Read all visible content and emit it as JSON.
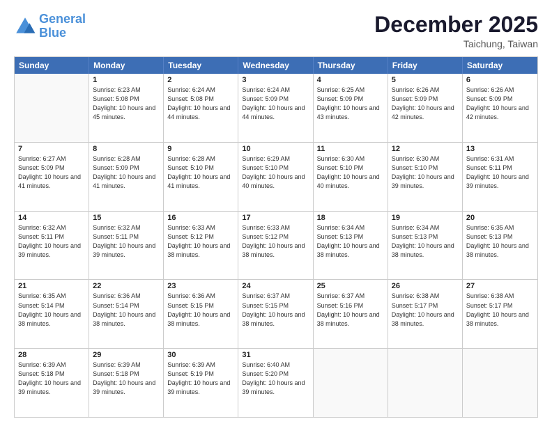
{
  "logo": {
    "line1": "General",
    "line2": "Blue"
  },
  "header": {
    "month": "December 2025",
    "location": "Taichung, Taiwan"
  },
  "days": [
    "Sunday",
    "Monday",
    "Tuesday",
    "Wednesday",
    "Thursday",
    "Friday",
    "Saturday"
  ],
  "weeks": [
    [
      {
        "day": "",
        "sunrise": "",
        "sunset": "",
        "daylight": ""
      },
      {
        "day": "1",
        "sunrise": "Sunrise: 6:23 AM",
        "sunset": "Sunset: 5:08 PM",
        "daylight": "Daylight: 10 hours and 45 minutes."
      },
      {
        "day": "2",
        "sunrise": "Sunrise: 6:24 AM",
        "sunset": "Sunset: 5:08 PM",
        "daylight": "Daylight: 10 hours and 44 minutes."
      },
      {
        "day": "3",
        "sunrise": "Sunrise: 6:24 AM",
        "sunset": "Sunset: 5:09 PM",
        "daylight": "Daylight: 10 hours and 44 minutes."
      },
      {
        "day": "4",
        "sunrise": "Sunrise: 6:25 AM",
        "sunset": "Sunset: 5:09 PM",
        "daylight": "Daylight: 10 hours and 43 minutes."
      },
      {
        "day": "5",
        "sunrise": "Sunrise: 6:26 AM",
        "sunset": "Sunset: 5:09 PM",
        "daylight": "Daylight: 10 hours and 42 minutes."
      },
      {
        "day": "6",
        "sunrise": "Sunrise: 6:26 AM",
        "sunset": "Sunset: 5:09 PM",
        "daylight": "Daylight: 10 hours and 42 minutes."
      }
    ],
    [
      {
        "day": "7",
        "sunrise": "Sunrise: 6:27 AM",
        "sunset": "Sunset: 5:09 PM",
        "daylight": "Daylight: 10 hours and 41 minutes."
      },
      {
        "day": "8",
        "sunrise": "Sunrise: 6:28 AM",
        "sunset": "Sunset: 5:09 PM",
        "daylight": "Daylight: 10 hours and 41 minutes."
      },
      {
        "day": "9",
        "sunrise": "Sunrise: 6:28 AM",
        "sunset": "Sunset: 5:10 PM",
        "daylight": "Daylight: 10 hours and 41 minutes."
      },
      {
        "day": "10",
        "sunrise": "Sunrise: 6:29 AM",
        "sunset": "Sunset: 5:10 PM",
        "daylight": "Daylight: 10 hours and 40 minutes."
      },
      {
        "day": "11",
        "sunrise": "Sunrise: 6:30 AM",
        "sunset": "Sunset: 5:10 PM",
        "daylight": "Daylight: 10 hours and 40 minutes."
      },
      {
        "day": "12",
        "sunrise": "Sunrise: 6:30 AM",
        "sunset": "Sunset: 5:10 PM",
        "daylight": "Daylight: 10 hours and 39 minutes."
      },
      {
        "day": "13",
        "sunrise": "Sunrise: 6:31 AM",
        "sunset": "Sunset: 5:11 PM",
        "daylight": "Daylight: 10 hours and 39 minutes."
      }
    ],
    [
      {
        "day": "14",
        "sunrise": "Sunrise: 6:32 AM",
        "sunset": "Sunset: 5:11 PM",
        "daylight": "Daylight: 10 hours and 39 minutes."
      },
      {
        "day": "15",
        "sunrise": "Sunrise: 6:32 AM",
        "sunset": "Sunset: 5:11 PM",
        "daylight": "Daylight: 10 hours and 39 minutes."
      },
      {
        "day": "16",
        "sunrise": "Sunrise: 6:33 AM",
        "sunset": "Sunset: 5:12 PM",
        "daylight": "Daylight: 10 hours and 38 minutes."
      },
      {
        "day": "17",
        "sunrise": "Sunrise: 6:33 AM",
        "sunset": "Sunset: 5:12 PM",
        "daylight": "Daylight: 10 hours and 38 minutes."
      },
      {
        "day": "18",
        "sunrise": "Sunrise: 6:34 AM",
        "sunset": "Sunset: 5:13 PM",
        "daylight": "Daylight: 10 hours and 38 minutes."
      },
      {
        "day": "19",
        "sunrise": "Sunrise: 6:34 AM",
        "sunset": "Sunset: 5:13 PM",
        "daylight": "Daylight: 10 hours and 38 minutes."
      },
      {
        "day": "20",
        "sunrise": "Sunrise: 6:35 AM",
        "sunset": "Sunset: 5:13 PM",
        "daylight": "Daylight: 10 hours and 38 minutes."
      }
    ],
    [
      {
        "day": "21",
        "sunrise": "Sunrise: 6:35 AM",
        "sunset": "Sunset: 5:14 PM",
        "daylight": "Daylight: 10 hours and 38 minutes."
      },
      {
        "day": "22",
        "sunrise": "Sunrise: 6:36 AM",
        "sunset": "Sunset: 5:14 PM",
        "daylight": "Daylight: 10 hours and 38 minutes."
      },
      {
        "day": "23",
        "sunrise": "Sunrise: 6:36 AM",
        "sunset": "Sunset: 5:15 PM",
        "daylight": "Daylight: 10 hours and 38 minutes."
      },
      {
        "day": "24",
        "sunrise": "Sunrise: 6:37 AM",
        "sunset": "Sunset: 5:15 PM",
        "daylight": "Daylight: 10 hours and 38 minutes."
      },
      {
        "day": "25",
        "sunrise": "Sunrise: 6:37 AM",
        "sunset": "Sunset: 5:16 PM",
        "daylight": "Daylight: 10 hours and 38 minutes."
      },
      {
        "day": "26",
        "sunrise": "Sunrise: 6:38 AM",
        "sunset": "Sunset: 5:17 PM",
        "daylight": "Daylight: 10 hours and 38 minutes."
      },
      {
        "day": "27",
        "sunrise": "Sunrise: 6:38 AM",
        "sunset": "Sunset: 5:17 PM",
        "daylight": "Daylight: 10 hours and 38 minutes."
      }
    ],
    [
      {
        "day": "28",
        "sunrise": "Sunrise: 6:39 AM",
        "sunset": "Sunset: 5:18 PM",
        "daylight": "Daylight: 10 hours and 39 minutes."
      },
      {
        "day": "29",
        "sunrise": "Sunrise: 6:39 AM",
        "sunset": "Sunset: 5:18 PM",
        "daylight": "Daylight: 10 hours and 39 minutes."
      },
      {
        "day": "30",
        "sunrise": "Sunrise: 6:39 AM",
        "sunset": "Sunset: 5:19 PM",
        "daylight": "Daylight: 10 hours and 39 minutes."
      },
      {
        "day": "31",
        "sunrise": "Sunrise: 6:40 AM",
        "sunset": "Sunset: 5:20 PM",
        "daylight": "Daylight: 10 hours and 39 minutes."
      },
      {
        "day": "",
        "sunrise": "",
        "sunset": "",
        "daylight": ""
      },
      {
        "day": "",
        "sunrise": "",
        "sunset": "",
        "daylight": ""
      },
      {
        "day": "",
        "sunrise": "",
        "sunset": "",
        "daylight": ""
      }
    ]
  ]
}
